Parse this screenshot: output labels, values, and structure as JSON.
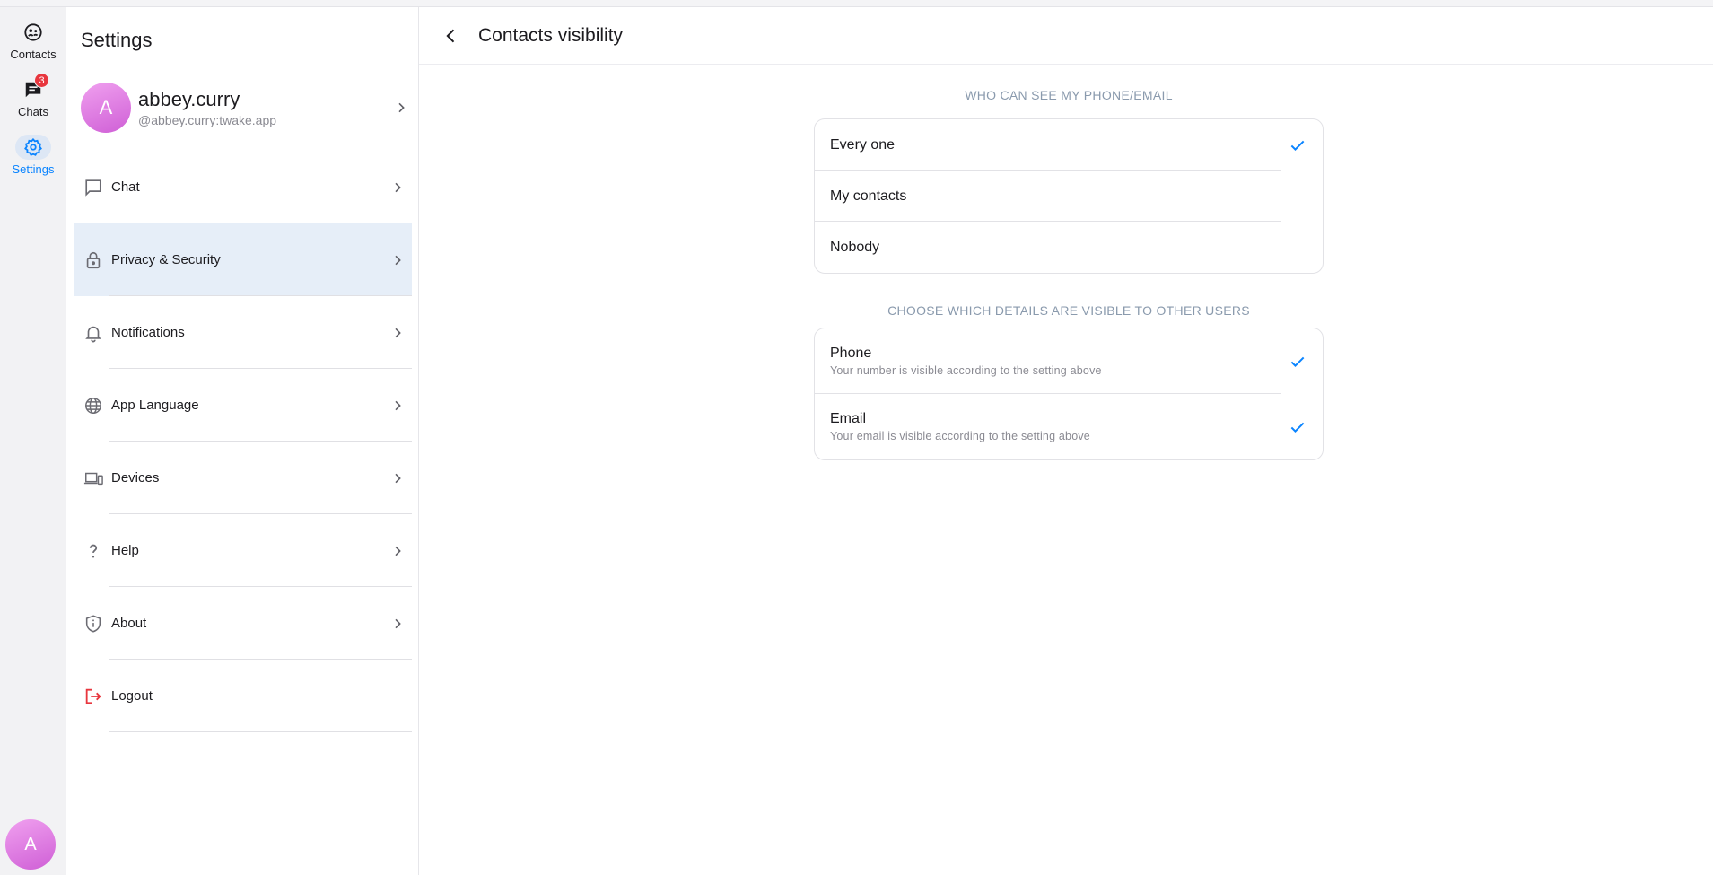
{
  "rail": {
    "items": [
      {
        "label": "Contacts",
        "icon": "contacts-icon"
      },
      {
        "label": "Chats",
        "icon": "chat-bubble-icon",
        "badge": "3"
      },
      {
        "label": "Settings",
        "icon": "gear-icon",
        "active": true
      }
    ],
    "avatar_letter": "A"
  },
  "settings": {
    "title": "Settings",
    "profile": {
      "avatar_letter": "A",
      "name": "abbey.curry",
      "id": "@abbey.curry:twake.app"
    },
    "menu": [
      {
        "label": "Chat",
        "icon": "chat-icon"
      },
      {
        "label": "Privacy & Security",
        "icon": "lock-icon",
        "active": true
      },
      {
        "label": "Notifications",
        "icon": "bell-icon"
      },
      {
        "label": "App Language",
        "icon": "globe-icon"
      },
      {
        "label": "Devices",
        "icon": "devices-icon"
      },
      {
        "label": "Help",
        "icon": "help-icon"
      },
      {
        "label": "About",
        "icon": "shield-info-icon"
      },
      {
        "label": "Logout",
        "icon": "logout-icon"
      }
    ]
  },
  "main": {
    "title": "Contacts visibility",
    "who_label": "WHO CAN SEE MY PHONE/EMAIL",
    "who_options": [
      {
        "label": "Every one",
        "selected": true
      },
      {
        "label": "My contacts",
        "selected": false
      },
      {
        "label": "Nobody",
        "selected": false
      }
    ],
    "details_label": "CHOOSE WHICH DETAILS ARE VISIBLE TO OTHER USERS",
    "details": [
      {
        "title": "Phone",
        "subtitle": "Your number is visible according to the setting above",
        "checked": true
      },
      {
        "title": "Email",
        "subtitle": "Your email is visible according to the setting above",
        "checked": true
      }
    ]
  },
  "colors": {
    "accent": "#0a84ff",
    "badge": "#e8363e",
    "active_bg": "#e6eef8",
    "logout": "#e8363e"
  }
}
